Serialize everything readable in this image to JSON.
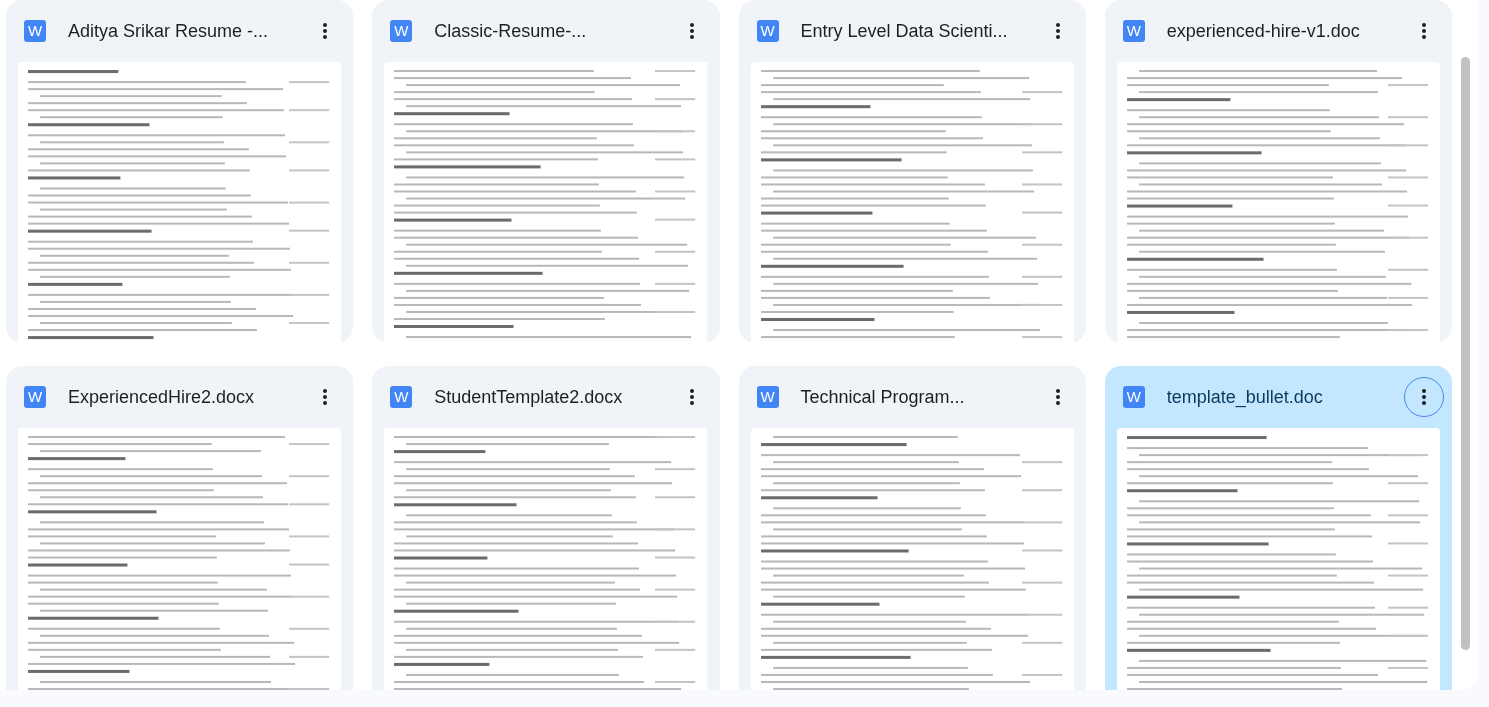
{
  "files": [
    {
      "name": "Aditya Srikar Resume -...",
      "icon_letter": "W",
      "selected": false
    },
    {
      "name": "Classic-Resume-...",
      "icon_letter": "W",
      "selected": false
    },
    {
      "name": "Entry Level Data Scienti...",
      "icon_letter": "W",
      "selected": false
    },
    {
      "name": "experienced-hire-v1.doc",
      "icon_letter": "W",
      "selected": false
    },
    {
      "name": "ExperiencedHire2.docx",
      "icon_letter": "W",
      "selected": false
    },
    {
      "name": "StudentTemplate2.docx",
      "icon_letter": "W",
      "selected": false
    },
    {
      "name": "Technical Program...",
      "icon_letter": "W",
      "selected": false
    },
    {
      "name": "template_bullet.doc",
      "icon_letter": "W",
      "selected": true
    }
  ]
}
